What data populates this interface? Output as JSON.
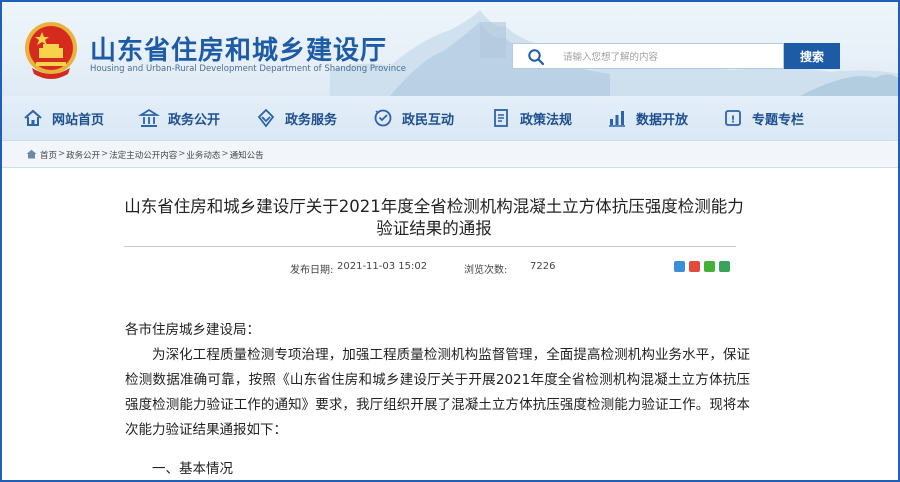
{
  "header": {
    "site_title": "山东省住房和城乡建设厅",
    "site_subtitle": "Housing and Urban-Rural Development Department of Shandong Province",
    "search_placeholder": "请输入您想了解的内容",
    "search_button": "搜索"
  },
  "nav": {
    "items": [
      {
        "label": "网站首页",
        "icon": "home-icon"
      },
      {
        "label": "政务公开",
        "icon": "building-icon"
      },
      {
        "label": "政务服务",
        "icon": "service-icon"
      },
      {
        "label": "政民互动",
        "icon": "interaction-icon"
      },
      {
        "label": "政策法规",
        "icon": "policy-icon"
      },
      {
        "label": "数据开放",
        "icon": "chart-icon"
      },
      {
        "label": "专题专栏",
        "icon": "topic-icon"
      }
    ]
  },
  "breadcrumb": {
    "items": [
      "首页",
      "政务公开",
      "法定主动公开内容",
      "业务动态",
      "通知公告"
    ],
    "separator": ">"
  },
  "article": {
    "title": "山东省住房和城乡建设厅关于2021年度全省检测机构混凝土立方体抗压强度检测能力验证结果的通报",
    "publish_label": "发布日期:",
    "publish_date": "2021-11-03 15:02",
    "views_label": "浏览次数:",
    "views": "7226",
    "salutation": "各市住房城乡建设局：",
    "paragraph1": "为深化工程质量检测专项治理，加强工程质量检测机构监督管理，全面提高检测机构业务水平，保证检测数据准确可靠，按照《山东省住房和城乡建设厅关于开展2021年度全省检测机构混凝土立方体抗压强度检测能力验证工作的通知》要求，我厅组织开展了混凝土立方体抗压强度检测能力验证工作。现将本次能力验证结果通报如下：",
    "section1": "一、基本情况"
  },
  "colors": {
    "brand_blue": "#1d5ba6",
    "nav_text": "#1d4f8f",
    "emblem_red": "#d52b1e",
    "emblem_gold": "#e7b33a"
  }
}
